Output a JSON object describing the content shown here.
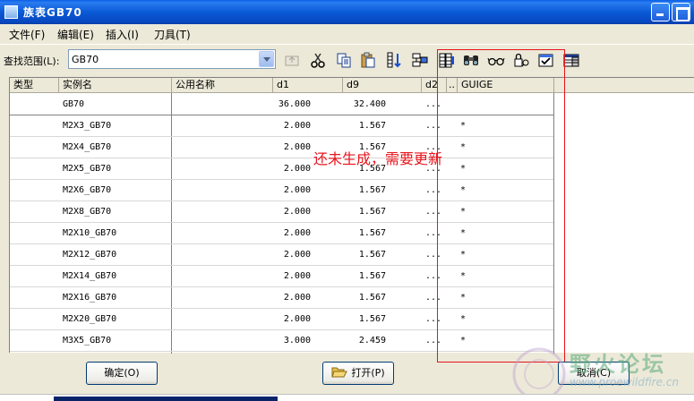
{
  "window": {
    "title": "族表GB70"
  },
  "menu": {
    "items": [
      "文件(F)",
      "编辑(E)",
      "插入(I)",
      "刀具(T)"
    ]
  },
  "toolbar": {
    "lookin_label": "查找范围(L):",
    "lookin_value": "GB70",
    "icons": [
      "up-folder-icon",
      "cut-icon",
      "copy-icon",
      "paste-icon",
      "insert-column-icon",
      "insert-row-icon",
      "edit-column-icon",
      "find-icon",
      "glasses-icon",
      "lock-icon",
      "verify-icon",
      "table-icon"
    ]
  },
  "table": {
    "headers": [
      "类型",
      "实例名",
      "公用名称",
      "d1",
      "d9",
      "d2",
      "..",
      "GUIGE"
    ],
    "rows": [
      {
        "type": "",
        "name": "GB70",
        "common": "",
        "d1": "36.000",
        "d9": "32.400",
        "d2": "...",
        "x": "",
        "guige": ""
      },
      {
        "type": "",
        "name": "M2X3_GB70",
        "common": "",
        "d1": "2.000",
        "d9": "1.567",
        "d2": "...",
        "x": "",
        "guige": "*"
      },
      {
        "type": "",
        "name": "M2X4_GB70",
        "common": "",
        "d1": "2.000",
        "d9": "1.567",
        "d2": "...",
        "x": "",
        "guige": "*"
      },
      {
        "type": "",
        "name": "M2X5_GB70",
        "common": "",
        "d1": "2.000",
        "d9": "1.567",
        "d2": "...",
        "x": "",
        "guige": "*"
      },
      {
        "type": "",
        "name": "M2X6_GB70",
        "common": "",
        "d1": "2.000",
        "d9": "1.567",
        "d2": "...",
        "x": "",
        "guige": "*"
      },
      {
        "type": "",
        "name": "M2X8_GB70",
        "common": "",
        "d1": "2.000",
        "d9": "1.567",
        "d2": "...",
        "x": "",
        "guige": "*"
      },
      {
        "type": "",
        "name": "M2X10_GB70",
        "common": "",
        "d1": "2.000",
        "d9": "1.567",
        "d2": "...",
        "x": "",
        "guige": "*"
      },
      {
        "type": "",
        "name": "M2X12_GB70",
        "common": "",
        "d1": "2.000",
        "d9": "1.567",
        "d2": "...",
        "x": "",
        "guige": "*"
      },
      {
        "type": "",
        "name": "M2X14_GB70",
        "common": "",
        "d1": "2.000",
        "d9": "1.567",
        "d2": "...",
        "x": "",
        "guige": "*"
      },
      {
        "type": "",
        "name": "M2X16_GB70",
        "common": "",
        "d1": "2.000",
        "d9": "1.567",
        "d2": "...",
        "x": "",
        "guige": "*"
      },
      {
        "type": "",
        "name": "M2X20_GB70",
        "common": "",
        "d1": "2.000",
        "d9": "1.567",
        "d2": "...",
        "x": "",
        "guige": "*"
      },
      {
        "type": "",
        "name": "M3X5_GB70",
        "common": "",
        "d1": "3.000",
        "d9": "2.459",
        "d2": "...",
        "x": "",
        "guige": "*"
      }
    ]
  },
  "annotation": {
    "text": "还未生成，需要更新",
    "color": "#e8141c"
  },
  "buttons": {
    "ok": "确定(O)",
    "open": "打开(P)",
    "cancel": "取消(C)"
  },
  "watermark": {
    "text": "野火论坛",
    "url": "www.proewildfire.cn"
  }
}
